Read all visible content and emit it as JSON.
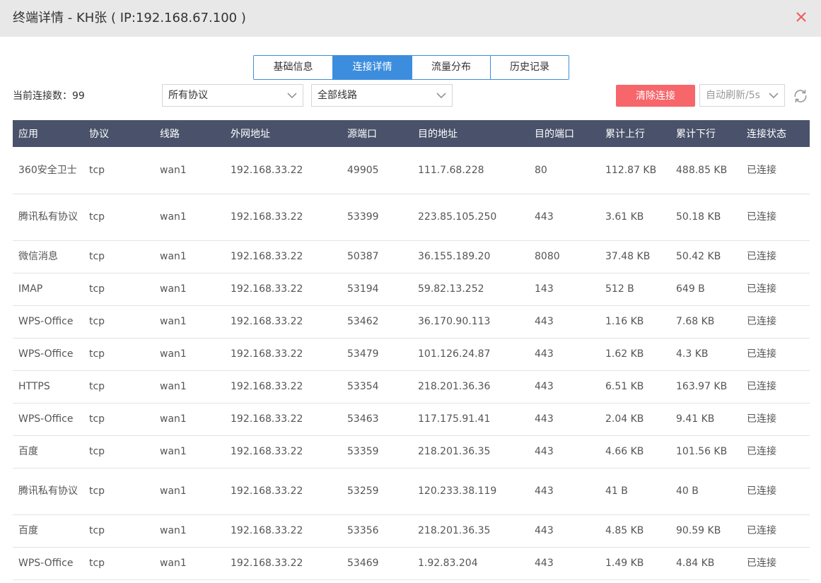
{
  "dialog": {
    "title": "终端详情 - KH张 ( IP:192.168.67.100 )"
  },
  "tabs": [
    {
      "label": "基础信息",
      "active": false
    },
    {
      "label": "连接详情",
      "active": true
    },
    {
      "label": "流量分布",
      "active": false
    },
    {
      "label": "历史记录",
      "active": false
    }
  ],
  "toolbar": {
    "count_label": "当前连接数：99",
    "protocol_select": "所有协议",
    "line_select": "全部线路",
    "clear_button": "清除连接",
    "refresh_select": "自动刷新/5s"
  },
  "colors": {
    "accent": "#3c8dde",
    "header_bg": "#49526a",
    "danger": "#f6666b"
  },
  "table": {
    "columns": [
      "应用",
      "协议",
      "线路",
      "外网地址",
      "源端口",
      "目的地址",
      "目的端口",
      "累计上行",
      "累计下行",
      "连接状态"
    ],
    "rows": [
      [
        "360安全卫士",
        "tcp",
        "wan1",
        "192.168.33.22",
        "49905",
        "111.7.68.228",
        "80",
        "112.87 KB",
        "488.85 KB",
        "已连接"
      ],
      [
        "腾讯私有协议",
        "tcp",
        "wan1",
        "192.168.33.22",
        "53399",
        "223.85.105.250",
        "443",
        "3.61 KB",
        "50.18 KB",
        "已连接"
      ],
      [
        "微信消息",
        "tcp",
        "wan1",
        "192.168.33.22",
        "50387",
        "36.155.189.20",
        "8080",
        "37.48 KB",
        "50.42 KB",
        "已连接"
      ],
      [
        "IMAP",
        "tcp",
        "wan1",
        "192.168.33.22",
        "53194",
        "59.82.13.252",
        "143",
        "512 B",
        "649 B",
        "已连接"
      ],
      [
        "WPS-Office",
        "tcp",
        "wan1",
        "192.168.33.22",
        "53462",
        "36.170.90.113",
        "443",
        "1.16 KB",
        "7.68 KB",
        "已连接"
      ],
      [
        "WPS-Office",
        "tcp",
        "wan1",
        "192.168.33.22",
        "53479",
        "101.126.24.87",
        "443",
        "1.62 KB",
        "4.3 KB",
        "已连接"
      ],
      [
        "HTTPS",
        "tcp",
        "wan1",
        "192.168.33.22",
        "53354",
        "218.201.36.36",
        "443",
        "6.51 KB",
        "163.97 KB",
        "已连接"
      ],
      [
        "WPS-Office",
        "tcp",
        "wan1",
        "192.168.33.22",
        "53463",
        "117.175.91.41",
        "443",
        "2.04 KB",
        "9.41 KB",
        "已连接"
      ],
      [
        "百度",
        "tcp",
        "wan1",
        "192.168.33.22",
        "53359",
        "218.201.36.35",
        "443",
        "4.66 KB",
        "101.56 KB",
        "已连接"
      ],
      [
        "腾讯私有协议",
        "tcp",
        "wan1",
        "192.168.33.22",
        "53259",
        "120.233.38.119",
        "443",
        "41 B",
        "40 B",
        "已连接"
      ],
      [
        "百度",
        "tcp",
        "wan1",
        "192.168.33.22",
        "53356",
        "218.201.36.35",
        "443",
        "4.85 KB",
        "90.59 KB",
        "已连接"
      ],
      [
        "WPS-Office",
        "tcp",
        "wan1",
        "192.168.33.22",
        "53469",
        "1.92.83.204",
        "443",
        "1.49 KB",
        "4.84 KB",
        "已连接"
      ]
    ]
  }
}
